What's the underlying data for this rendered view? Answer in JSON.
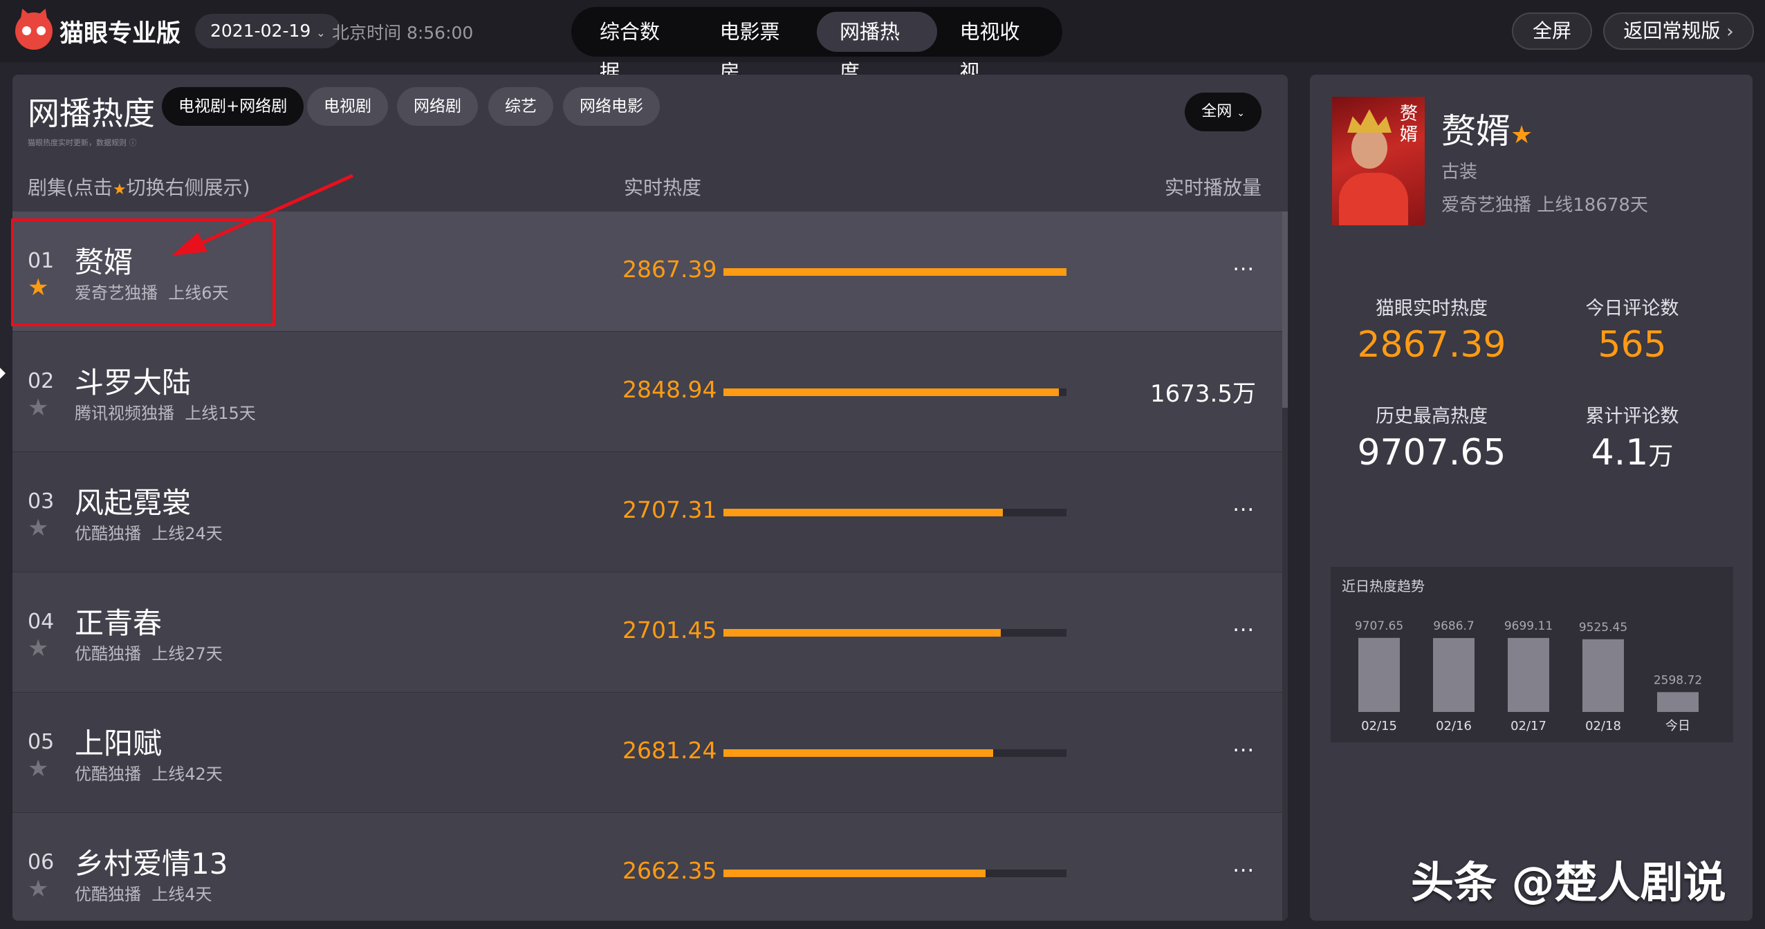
{
  "header": {
    "logo_text": "猫眼专业版",
    "date": "2021-02-19",
    "clock": "北京时间 8:56:00",
    "nav": [
      "综合数据",
      "电影票房",
      "网播热度",
      "电视收视"
    ],
    "active_nav_index": 2,
    "fullscreen_label": "全屏",
    "back_label": "返回常规版"
  },
  "main": {
    "title": "网播热度",
    "subtitle": "猫眼热度实时更新，数据规则",
    "filters": [
      "电视剧+网络剧",
      "电视剧",
      "网络剧",
      "综艺",
      "网络电影"
    ],
    "active_filter_index": 0,
    "scope": "全网",
    "columns": {
      "series_prefix": "剧集(点击",
      "series_suffix": "切换右侧展示)",
      "heat": "实时热度",
      "plays": "实时播放量"
    },
    "rows": [
      {
        "rank": "01",
        "name": "赘婿",
        "platform": "爱奇艺独播",
        "days": "上线6天",
        "heat": "2867.39",
        "heat_value": 2867.39,
        "plays": "...",
        "starred": true
      },
      {
        "rank": "02",
        "name": "斗罗大陆",
        "platform": "腾讯视频独播",
        "days": "上线15天",
        "heat": "2848.94",
        "heat_value": 2848.94,
        "plays": "1673.5万",
        "starred": false
      },
      {
        "rank": "03",
        "name": "风起霓裳",
        "platform": "优酷独播",
        "days": "上线24天",
        "heat": "2707.31",
        "heat_value": 2707.31,
        "plays": "...",
        "starred": false
      },
      {
        "rank": "04",
        "name": "正青春",
        "platform": "优酷独播",
        "days": "上线27天",
        "heat": "2701.45",
        "heat_value": 2701.45,
        "plays": "...",
        "starred": false
      },
      {
        "rank": "05",
        "name": "上阳赋",
        "platform": "优酷独播",
        "days": "上线42天",
        "heat": "2681.24",
        "heat_value": 2681.24,
        "plays": "...",
        "starred": false
      },
      {
        "rank": "06",
        "name": "乡村爱情13",
        "platform": "优酷独播",
        "days": "上线4天",
        "heat": "2662.35",
        "heat_value": 2662.35,
        "plays": "...",
        "starred": false
      }
    ]
  },
  "detail": {
    "name": "赘婿",
    "poster_title": "赘婿",
    "genre": "古装",
    "info": "爱奇艺独播  上线18678天",
    "stats": {
      "realtime_label": "猫眼实时热度",
      "realtime_value": "2867.39",
      "today_comments_label": "今日评论数",
      "today_comments_value": "565",
      "history_max_label": "历史最高热度",
      "history_max_value": "9707.65",
      "total_comments_label": "累计评论数",
      "total_comments_value": "4.1",
      "total_comments_unit": "万"
    },
    "trend": {
      "title": "近日热度趋势",
      "labels": [
        "9707.65",
        "9686.7",
        "9699.11",
        "9525.45",
        "2598.72"
      ]
    }
  },
  "chart_data": {
    "type": "bar",
    "title": "近日热度趋势",
    "categories": [
      "02/15",
      "02/16",
      "02/17",
      "02/18",
      "今日"
    ],
    "values": [
      9707.65,
      9686.7,
      9699.11,
      9525.45,
      2598.72
    ]
  },
  "watermark": "头条 @楚人剧说",
  "colors": {
    "accent": "#ff9b13",
    "annotation": "#e8101c",
    "panel": "#3a3944",
    "background": "#26242d"
  },
  "icons": {
    "star": "star-icon",
    "more": "more-icon",
    "chevron": "chevron-down-icon"
  }
}
